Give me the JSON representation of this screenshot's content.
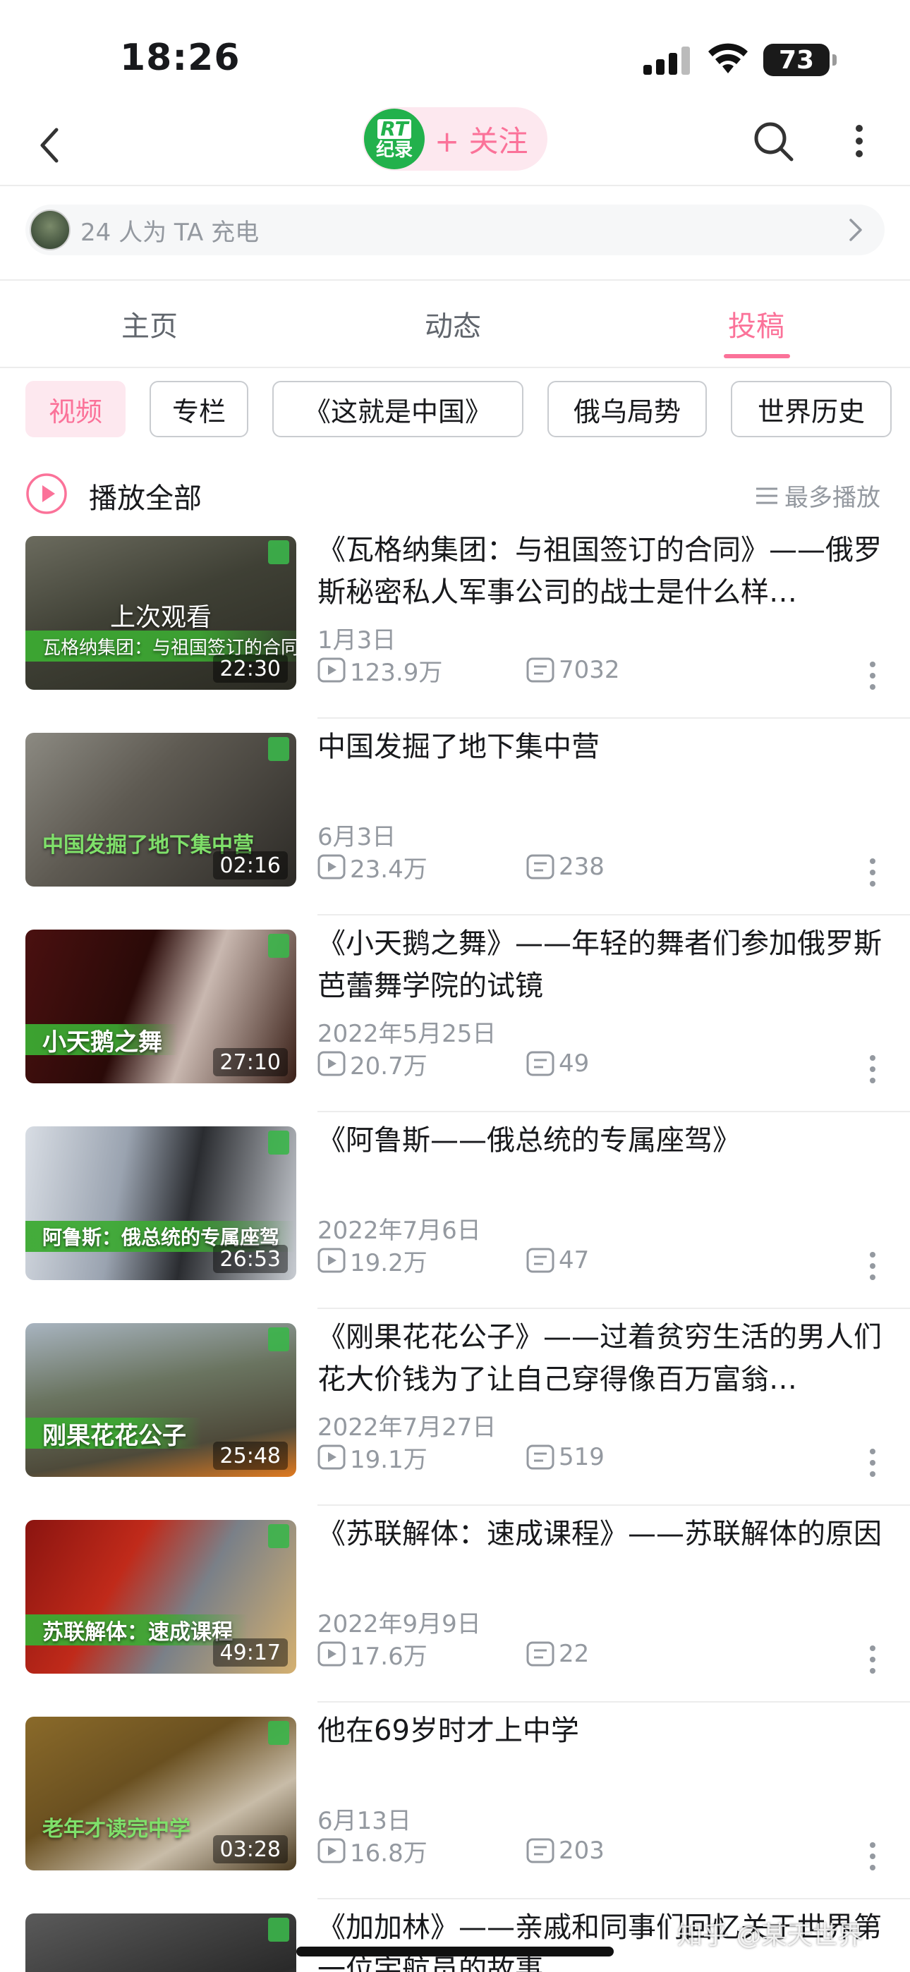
{
  "status_bar": {
    "time": "18:26",
    "battery": "73"
  },
  "header": {
    "channel_logo_top": "RT",
    "channel_logo_bottom": "纪录",
    "follow_label": "+ 关注"
  },
  "charge": {
    "text": "24 人为 TA 充电"
  },
  "tabs": [
    {
      "label": "主页",
      "active": false
    },
    {
      "label": "动态",
      "active": false
    },
    {
      "label": "投稿",
      "active": true
    }
  ],
  "filters": [
    "视频",
    "专栏",
    "《这就是中国》",
    "俄乌局势",
    "世界历史"
  ],
  "play_all": {
    "label": "播放全部",
    "sort_label": "最多播放"
  },
  "videos": [
    {
      "title": "《瓦格纳集团：与祖国签订的合同》——俄罗斯秘密私人军事公司的战士是什么样…",
      "date": "1月3日",
      "views": "123.9万",
      "comments": "7032",
      "duration": "22:30",
      "caption": "瓦格纳集团：与祖国签订的合同",
      "watched": "上次观看"
    },
    {
      "title": "中国发掘了地下集中营",
      "date": "6月3日",
      "views": "23.4万",
      "comments": "238",
      "duration": "02:16",
      "caption": "中国发掘了地下集中营"
    },
    {
      "title": "《小天鹅之舞》——年轻的舞者们参加俄罗斯芭蕾舞学院的试镜",
      "date": "2022年5月25日",
      "views": "20.7万",
      "comments": "49",
      "duration": "27:10",
      "caption": "小天鹅之舞"
    },
    {
      "title": "《阿鲁斯——俄总统的专属座驾》",
      "date": "2022年7月6日",
      "views": "19.2万",
      "comments": "47",
      "duration": "26:53",
      "caption": "阿鲁斯：俄总统的专属座驾"
    },
    {
      "title": "《刚果花花公子》——过着贫穷生活的男人们花大价钱为了让自己穿得像百万富翁…",
      "date": "2022年7月27日",
      "views": "19.1万",
      "comments": "519",
      "duration": "25:48",
      "caption": "刚果花花公子"
    },
    {
      "title": "《苏联解体：速成课程》——苏联解体的原因",
      "date": "2022年9月9日",
      "views": "17.6万",
      "comments": "22",
      "duration": "49:17",
      "caption": "苏联解体：速成课程"
    },
    {
      "title": "他在69岁时才上中学",
      "date": "6月13日",
      "views": "16.8万",
      "comments": "203",
      "duration": "03:28",
      "caption": "老年才读完中学"
    },
    {
      "title": "《加加林》——亲戚和同事们回忆关于世界第一位宇航员的故事",
      "date": "",
      "views": "",
      "comments": "",
      "duration": "",
      "caption": ""
    }
  ],
  "watermark": "知乎 @某天世界",
  "colors": {
    "accent": "#fb7299",
    "text": "#18191c",
    "secondary": "#9499a0",
    "channel_green": "#22b14c"
  }
}
